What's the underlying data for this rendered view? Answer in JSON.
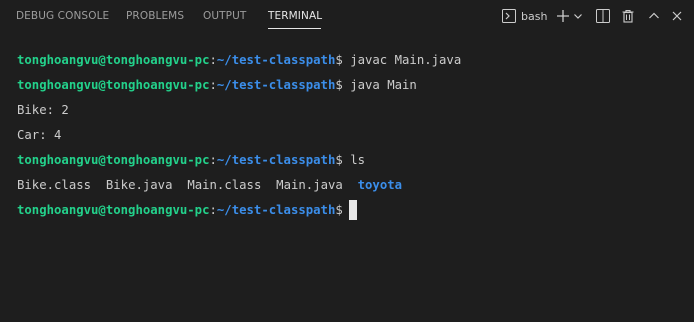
{
  "tabs": [
    {
      "label": "DEBUG CONSOLE"
    },
    {
      "label": "PROBLEMS"
    },
    {
      "label": "OUTPUT"
    },
    {
      "label": "TERMINAL"
    }
  ],
  "active_tab": "TERMINAL",
  "toolbar": {
    "shell_label": "bash",
    "icons": [
      "terminal-icon",
      "plus-icon",
      "chevron-down-icon",
      "split-icon",
      "trash-icon",
      "chevron-up-icon",
      "close-icon"
    ]
  },
  "prompt": {
    "user_host": "tonghoangvu@tonghoangvu-pc",
    "colon": ":",
    "path": "~/test-classpath",
    "symbol": "$"
  },
  "terminal_lines": [
    {
      "type": "command",
      "command": "javac Main.java"
    },
    {
      "type": "command",
      "command": "java Main"
    },
    {
      "type": "output",
      "text": "Bike: 2"
    },
    {
      "type": "output",
      "text": "Car: 4"
    },
    {
      "type": "command",
      "command": "ls"
    },
    {
      "type": "listing",
      "files": [
        "Bike.class",
        "Bike.java",
        "Main.class",
        "Main.java"
      ],
      "dirs": [
        "toyota"
      ]
    },
    {
      "type": "prompt"
    }
  ],
  "colors": {
    "background": "#1e1e1e",
    "user_host": "#23d18b",
    "path": "#3b8eea",
    "text": "#cccccc",
    "directory": "#3b8eea"
  }
}
